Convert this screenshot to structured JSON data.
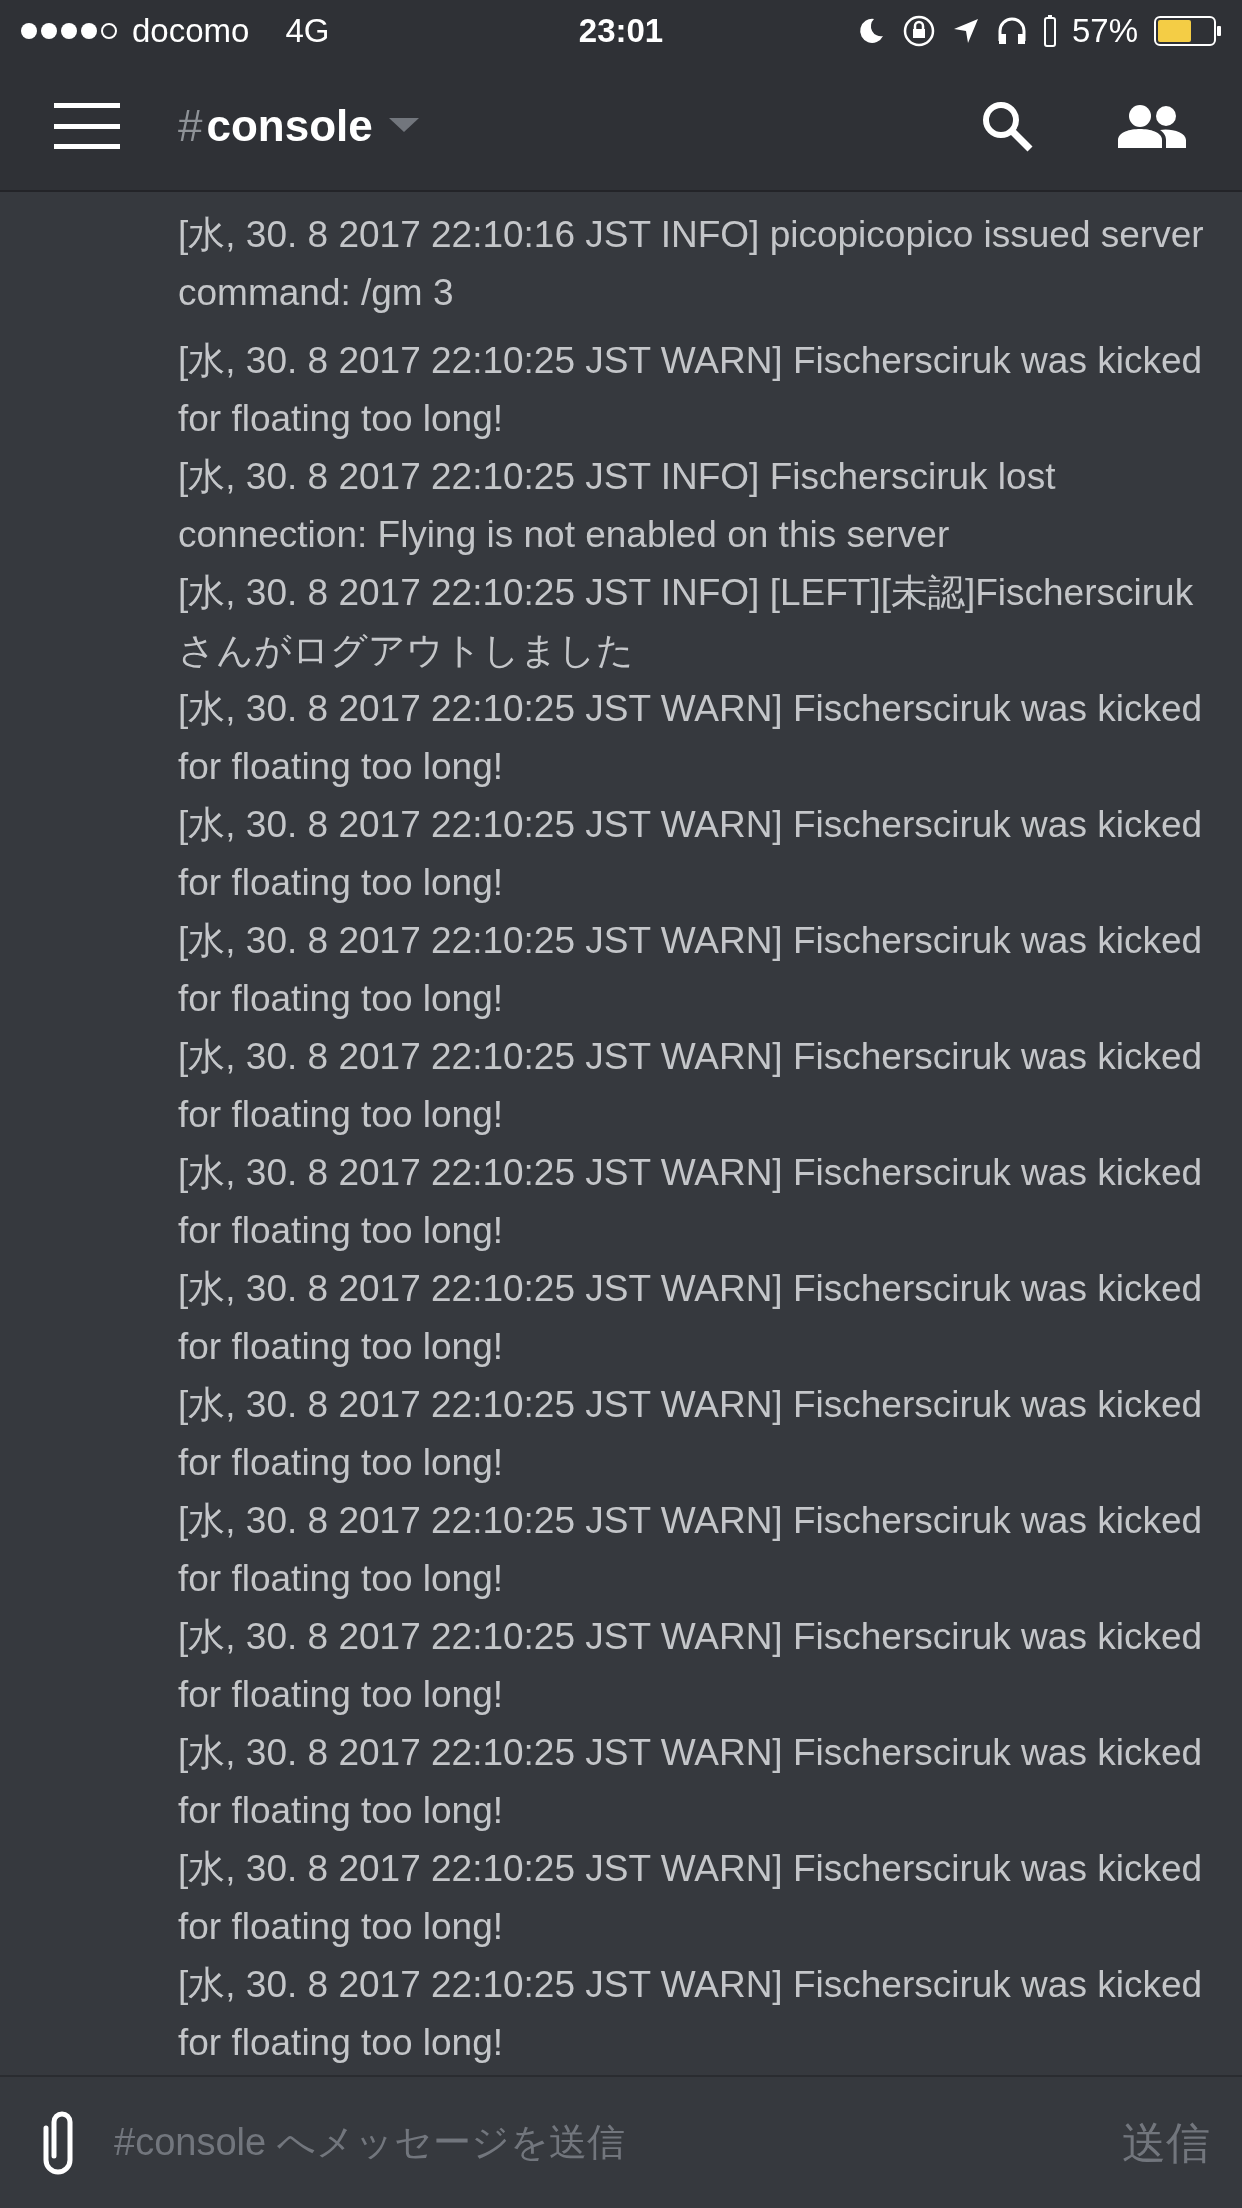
{
  "status_bar": {
    "carrier": "docomo",
    "network": "4G",
    "time": "23:01",
    "battery": "57%"
  },
  "header": {
    "hash": "#",
    "channel": "console"
  },
  "messages": [
    {
      "text": "[水, 30. 8 2017 22:10:16 JST INFO] picopicopico issued server command: /gm 3"
    },
    {
      "text": "[水, 30. 8 2017 22:10:25 JST WARN] Fischersciruk was kicked for floating too long!"
    },
    {
      "text": "[水, 30. 8 2017 22:10:25 JST INFO] Fischersciruk lost connection: Flying is not enabled on this server"
    },
    {
      "text": "[水, 30. 8 2017 22:10:25 JST INFO] [LEFT][未認]Fischersciruk さんがログアウトしました"
    },
    {
      "text": "[水, 30. 8 2017 22:10:25 JST WARN] Fischersciruk was kicked for floating too long!"
    },
    {
      "text": "[水, 30. 8 2017 22:10:25 JST WARN] Fischersciruk was kicked for floating too long!"
    },
    {
      "text": "[水, 30. 8 2017 22:10:25 JST WARN] Fischersciruk was kicked for floating too long!"
    },
    {
      "text": "[水, 30. 8 2017 22:10:25 JST WARN] Fischersciruk was kicked for floating too long!"
    },
    {
      "text": "[水, 30. 8 2017 22:10:25 JST WARN] Fischersciruk was kicked for floating too long!"
    },
    {
      "text": "[水, 30. 8 2017 22:10:25 JST WARN] Fischersciruk was kicked for floating too long!"
    },
    {
      "text": "[水, 30. 8 2017 22:10:25 JST WARN] Fischersciruk was kicked for floating too long!"
    },
    {
      "text": "[水, 30. 8 2017 22:10:25 JST WARN] Fischersciruk was kicked for floating too long!"
    },
    {
      "text": "[水, 30. 8 2017 22:10:25 JST WARN] Fischersciruk was kicked for floating too long!"
    },
    {
      "text": "[水, 30. 8 2017 22:10:25 JST WARN] Fischersciruk was kicked for floating too long!"
    },
    {
      "text": "[水, 30. 8 2017 22:10:25 JST WARN] Fischersciruk was kicked for floating too long!"
    },
    {
      "text": "[水, 30. 8 2017 22:10:25 JST WARN] Fischersciruk was kicked for floating too long!"
    }
  ],
  "composer": {
    "placeholder": "#console へメッセージを送信",
    "send": "送信"
  }
}
